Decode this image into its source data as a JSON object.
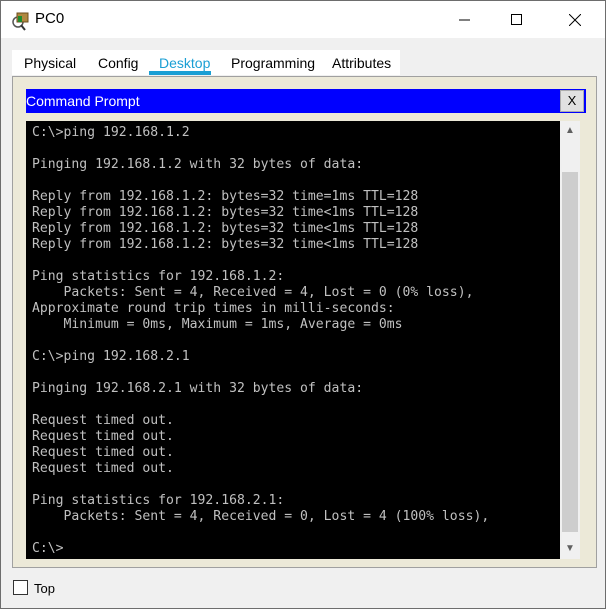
{
  "window": {
    "title": "PC0",
    "minimize_icon": "minimize-icon",
    "maximize_icon": "maximize-icon",
    "close_icon": "close-icon"
  },
  "tabs": [
    {
      "label": "Physical"
    },
    {
      "label": "Config"
    },
    {
      "label": "Desktop",
      "active": true
    },
    {
      "label": "Programming"
    },
    {
      "label": "Attributes"
    }
  ],
  "accent": "#1a9fd4",
  "cmd": {
    "title": "Command Prompt",
    "close_label": "X",
    "titlebar_color": "#0000ff"
  },
  "terminal_lines": [
    "C:\\>ping 192.168.1.2",
    "",
    "Pinging 192.168.1.2 with 32 bytes of data:",
    "",
    "Reply from 192.168.1.2: bytes=32 time=1ms TTL=128",
    "Reply from 192.168.1.2: bytes=32 time<1ms TTL=128",
    "Reply from 192.168.1.2: bytes=32 time<1ms TTL=128",
    "Reply from 192.168.1.2: bytes=32 time<1ms TTL=128",
    "",
    "Ping statistics for 192.168.1.2:",
    "    Packets: Sent = 4, Received = 4, Lost = 0 (0% loss),",
    "Approximate round trip times in milli-seconds:",
    "    Minimum = 0ms, Maximum = 1ms, Average = 0ms",
    "",
    "C:\\>ping 192.168.2.1",
    "",
    "Pinging 192.168.2.1 with 32 bytes of data:",
    "",
    "Request timed out.",
    "Request timed out.",
    "Request timed out.",
    "Request timed out.",
    "",
    "Ping statistics for 192.168.2.1:",
    "    Packets: Sent = 4, Received = 0, Lost = 4 (100% loss),",
    "",
    "C:\\>"
  ],
  "footer": {
    "top_label": "Top",
    "top_checked": false
  }
}
